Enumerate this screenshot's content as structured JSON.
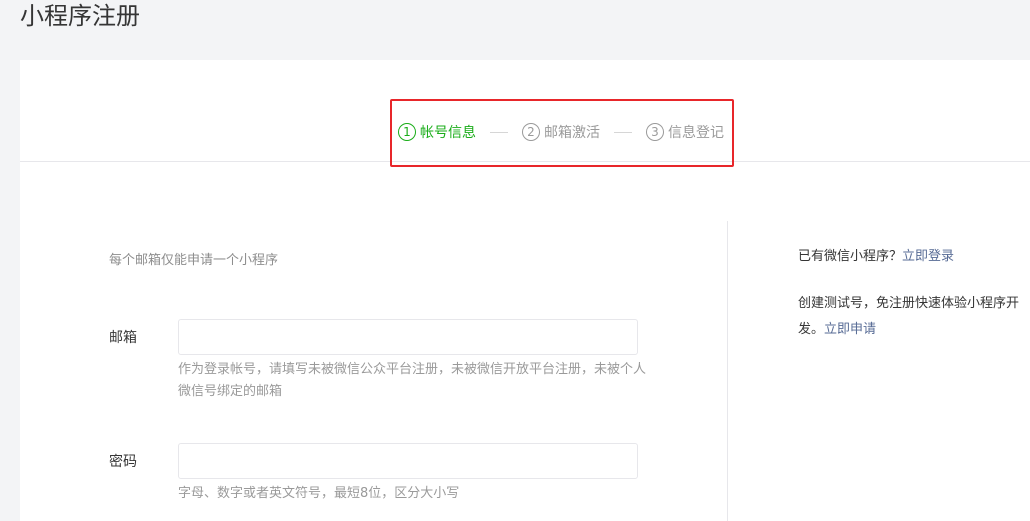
{
  "page_title": "小程序注册",
  "steps": [
    {
      "num": "1",
      "label": "帐号信息",
      "state": "active"
    },
    {
      "num": "2",
      "label": "邮箱激活",
      "state": "inactive"
    },
    {
      "num": "3",
      "label": "信息登记",
      "state": "inactive"
    }
  ],
  "form": {
    "tip": "每个邮箱仅能申请一个小程序",
    "email": {
      "label": "邮箱",
      "value": "",
      "placeholder": "",
      "hint": "作为登录帐号，请填写未被微信公众平台注册，未被微信开放平台注册，未被个人微信号绑定的邮箱"
    },
    "password": {
      "label": "密码",
      "value": "",
      "placeholder": "",
      "hint": "字母、数字或者英文符号，最短8位，区分大小写"
    }
  },
  "sidebar": {
    "login_prompt": "已有微信小程序？",
    "login_link": "立即登录",
    "test_prompt_line1": "创建测试号，免注册快速体验小程序开",
    "test_prompt_line2": "发。",
    "test_link": "立即申请"
  },
  "colors": {
    "active": "#1aad19",
    "inactive": "#9a9a9a",
    "highlight": "#e8262a",
    "link": "#576b95"
  }
}
